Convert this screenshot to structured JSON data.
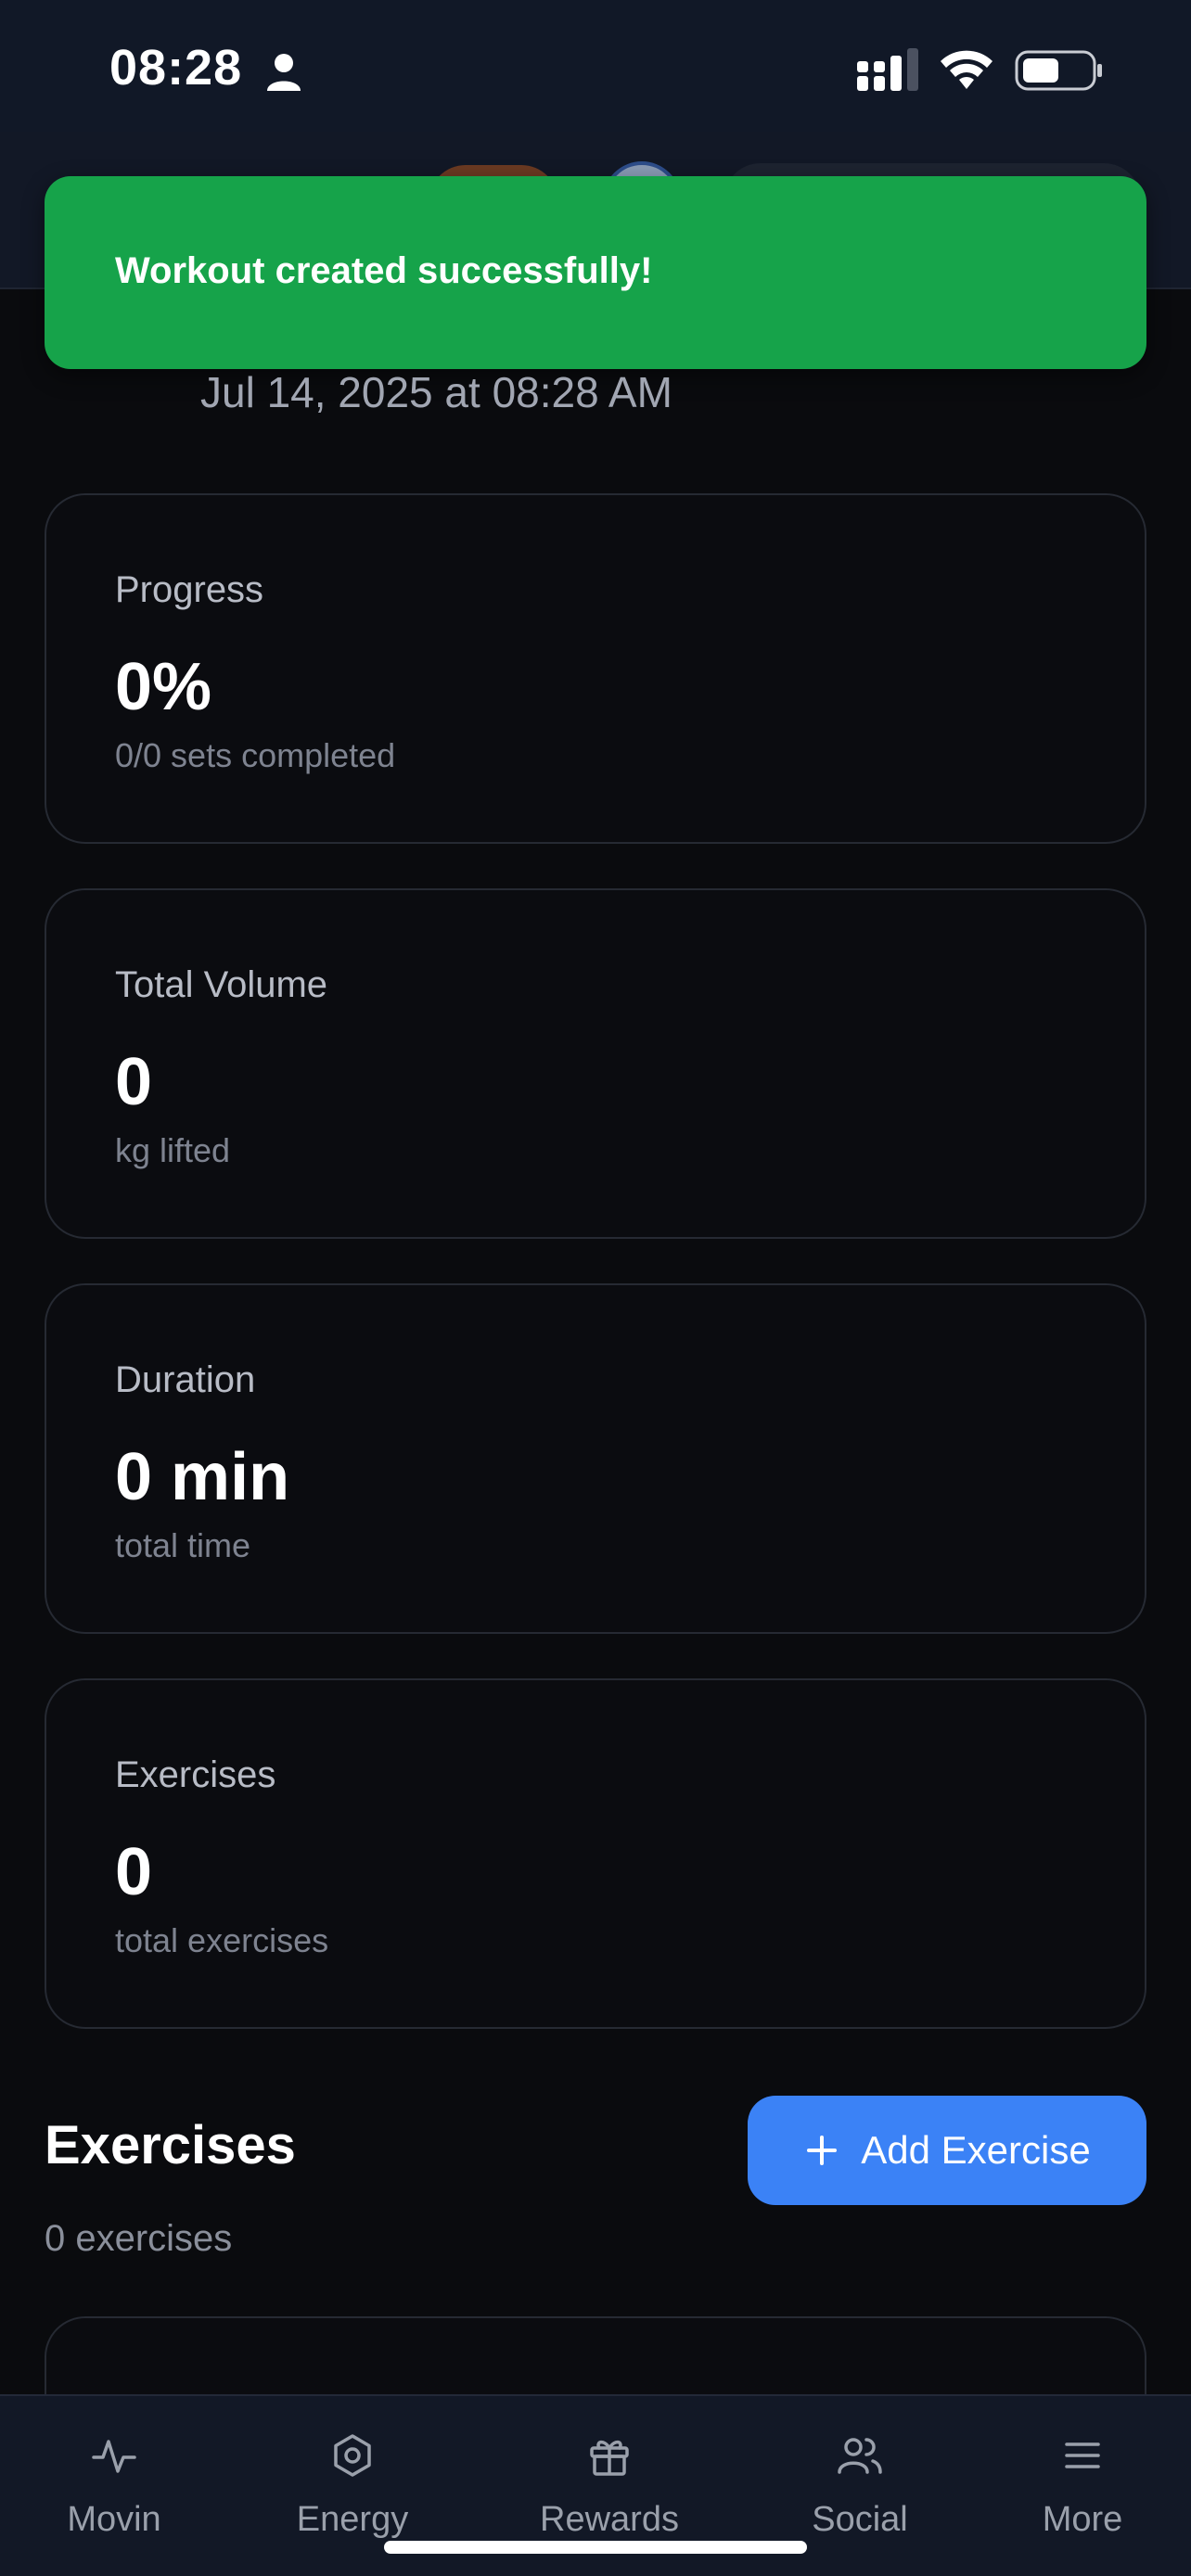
{
  "status_bar": {
    "time": "08:28"
  },
  "toast": {
    "message": "Workout created successfully!",
    "color": "#16a34a"
  },
  "workout": {
    "date": "Jul 14, 2025 at 08:28 AM"
  },
  "stats": [
    {
      "label": "Progress",
      "value": "0%",
      "sub": "0/0 sets completed"
    },
    {
      "label": "Total Volume",
      "value": "0",
      "sub": "kg lifted"
    },
    {
      "label": "Duration",
      "value": "0 min",
      "sub": "total time"
    },
    {
      "label": "Exercises",
      "value": "0",
      "sub": "total exercises"
    }
  ],
  "exercises_section": {
    "title": "Exercises",
    "count": "0 exercises",
    "add_button": "Add Exercise",
    "add_button_icon": "plus-icon",
    "accent": "#3b82f6"
  },
  "bottom_nav": [
    {
      "label": "Movin",
      "icon": "activity-icon"
    },
    {
      "label": "Energy",
      "icon": "hexagon-icon"
    },
    {
      "label": "Rewards",
      "icon": "gift-icon"
    },
    {
      "label": "Social",
      "icon": "users-icon"
    },
    {
      "label": "More",
      "icon": "menu-icon"
    }
  ]
}
